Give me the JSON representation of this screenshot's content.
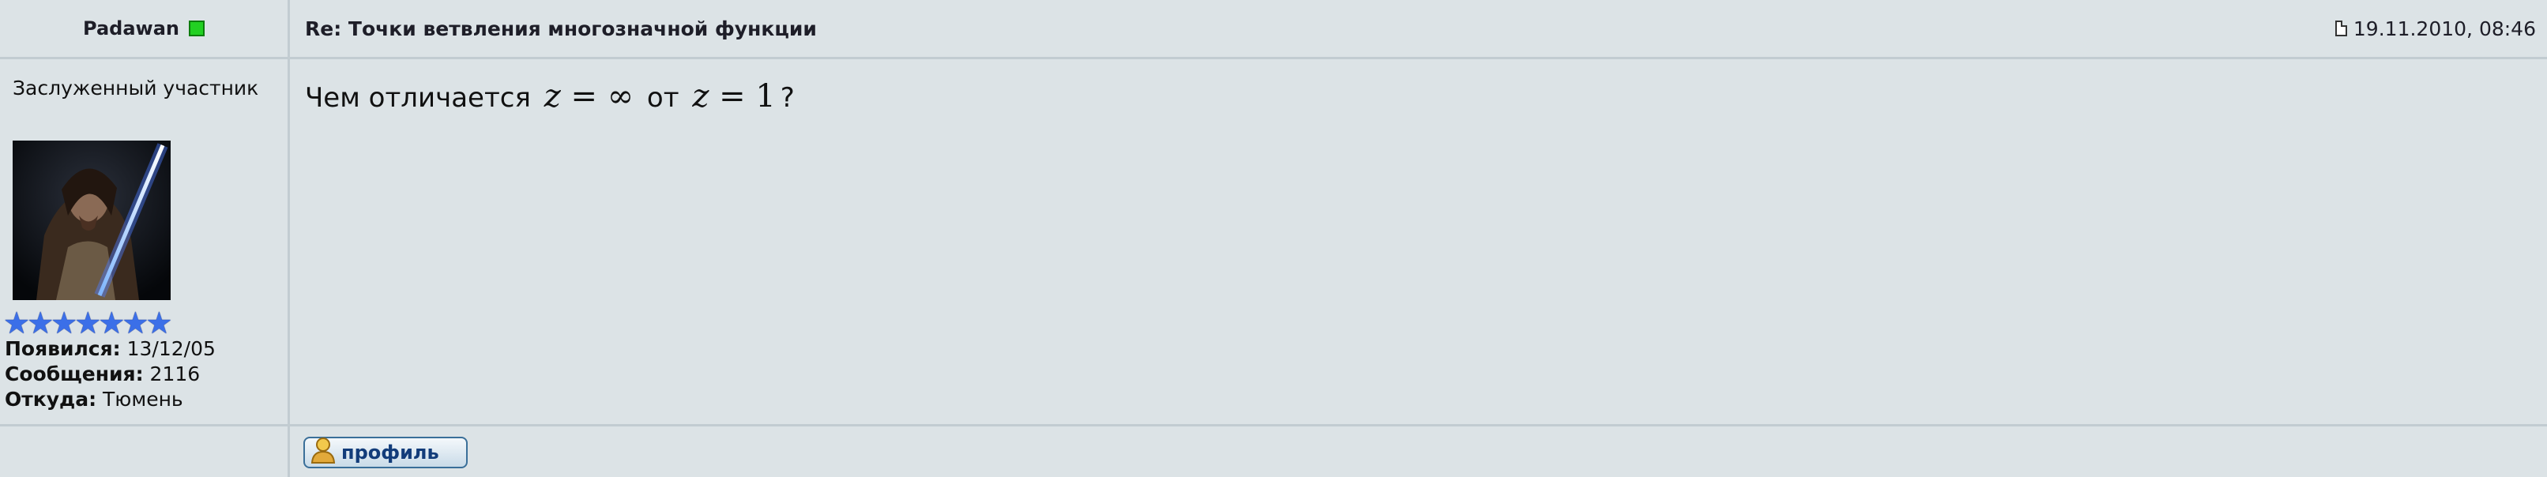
{
  "post": {
    "author": "Padawan",
    "subject": "Re: Точки ветвления многозначной функции",
    "date": "19.11.2010, 08:46",
    "rank": "Заслуженный участник",
    "stars": "★★★★★★★",
    "stats": [
      {
        "label": "Появился:",
        "value": "13/12/05"
      },
      {
        "label": "Сообщения:",
        "value": "2116"
      },
      {
        "label": "Откуда:",
        "value": "Тюмень"
      }
    ],
    "message": {
      "text_before": "Чем отличается",
      "math1_var": "z",
      "math1_rest": " = ∞",
      "text_middle": "от",
      "math2_var": "z",
      "math2_rest": " = 1",
      "text_after": "?"
    },
    "profile_label": "профиль"
  },
  "colors": {
    "background": "#dce3e6",
    "separator": "#c2ccd1",
    "online": "#22d022",
    "stars": "#3b6fe8"
  }
}
